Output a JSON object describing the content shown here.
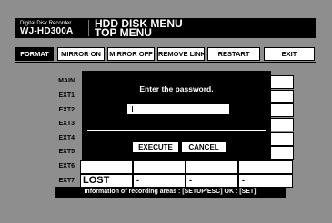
{
  "header": {
    "brand_top": "Digital Disk Recorder",
    "model": "WJ-HD300A",
    "title_line1": "HDD DISK MENU",
    "title_line2": "TOP MENU"
  },
  "menu": [
    {
      "label": "FORMAT",
      "selected": true
    },
    {
      "label": "MIRROR ON"
    },
    {
      "label": "MIRROR OFF"
    },
    {
      "label": "REMOVE LINK"
    },
    {
      "label": "RESTART"
    },
    {
      "label": "EXIT"
    }
  ],
  "areas": {
    "labels": [
      "MAIN",
      "EXT1",
      "EXT2",
      "EXT3",
      "EXT4",
      "EXT5",
      "EXT6",
      "EXT7"
    ],
    "ext7_cells": [
      "LOST",
      "-",
      "-",
      "-"
    ]
  },
  "dialog": {
    "prompt": "Enter the password.",
    "password_value": "",
    "execute_label": "EXECUTE",
    "cancel_label": "CANCEL"
  },
  "status_bar": "Information of recording areas : [SETUP/ESC] OK : [SET]",
  "colors": {
    "background": "#8e8e8e",
    "bar": "#000000",
    "cell": "#ffffff"
  }
}
